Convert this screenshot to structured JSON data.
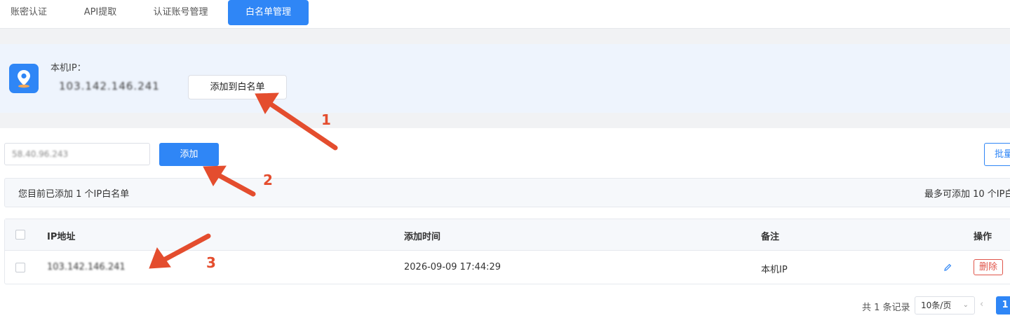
{
  "tabs": [
    {
      "label": "账密认证",
      "active": false
    },
    {
      "label": "API提取",
      "active": false
    },
    {
      "label": "认证账号管理",
      "active": false
    },
    {
      "label": "白名单管理",
      "active": true
    }
  ],
  "local_ip": {
    "label": "本机IP：",
    "value": "103.142.146.241",
    "add_button": "添加到白名单"
  },
  "add_form": {
    "input_value": "58.40.96.243",
    "add_button": "添加",
    "batch_button": "批量"
  },
  "info": {
    "added_text": "您目前已添加 1 个IP白名单",
    "limit_text": "最多可添加 10 个IP白"
  },
  "table": {
    "headers": {
      "ip": "IP地址",
      "time": "添加时间",
      "remark": "备注",
      "action": "操作"
    },
    "rows": [
      {
        "ip": "103.142.146.241",
        "time": "2026-09-09 17:44:29",
        "remark": "本机IP",
        "delete": "删除"
      }
    ]
  },
  "pagination": {
    "total": "共 1 条记录",
    "page_size": "10条/页",
    "prev": "‹",
    "current": "1"
  },
  "annotations": [
    "1",
    "2",
    "3"
  ],
  "colors": {
    "primary": "#2f86f6",
    "danger": "#e0554a",
    "annotation": "#e44d2e"
  }
}
